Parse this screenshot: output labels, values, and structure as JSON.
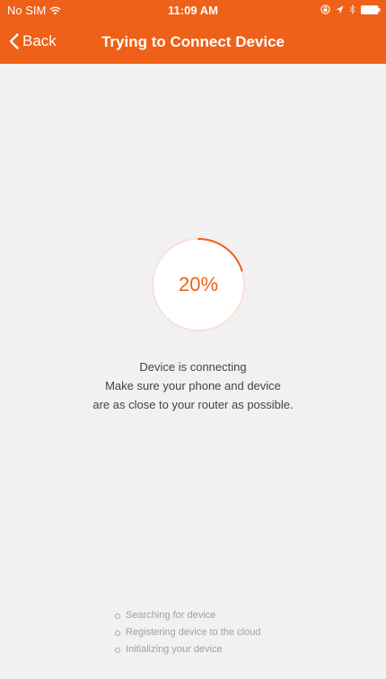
{
  "status_bar": {
    "carrier": "No SIM",
    "time": "11:09 AM"
  },
  "nav": {
    "back_label": "Back",
    "title": "Trying to Connect Device"
  },
  "progress": {
    "label": "20%",
    "fraction": 0.2
  },
  "message": {
    "line1": "Device is connecting",
    "line2": "Make sure your phone and device",
    "line3": "are as close to your router as possible."
  },
  "steps": [
    {
      "label": "Searching for device"
    },
    {
      "label": "Registering device to the cloud"
    },
    {
      "label": "Initializing your device"
    }
  ],
  "colors": {
    "accent": "#ef6018",
    "ring_track": "#f8e2d6",
    "background": "#f1f1f1"
  },
  "icons": {
    "back": "chevron-left-icon",
    "wifi": "wifi-icon",
    "lock": "orientation-lock-icon",
    "location": "location-arrow-icon",
    "bluetooth": "bluetooth-icon",
    "battery": "battery-icon",
    "step": "circle-bullet-icon"
  }
}
